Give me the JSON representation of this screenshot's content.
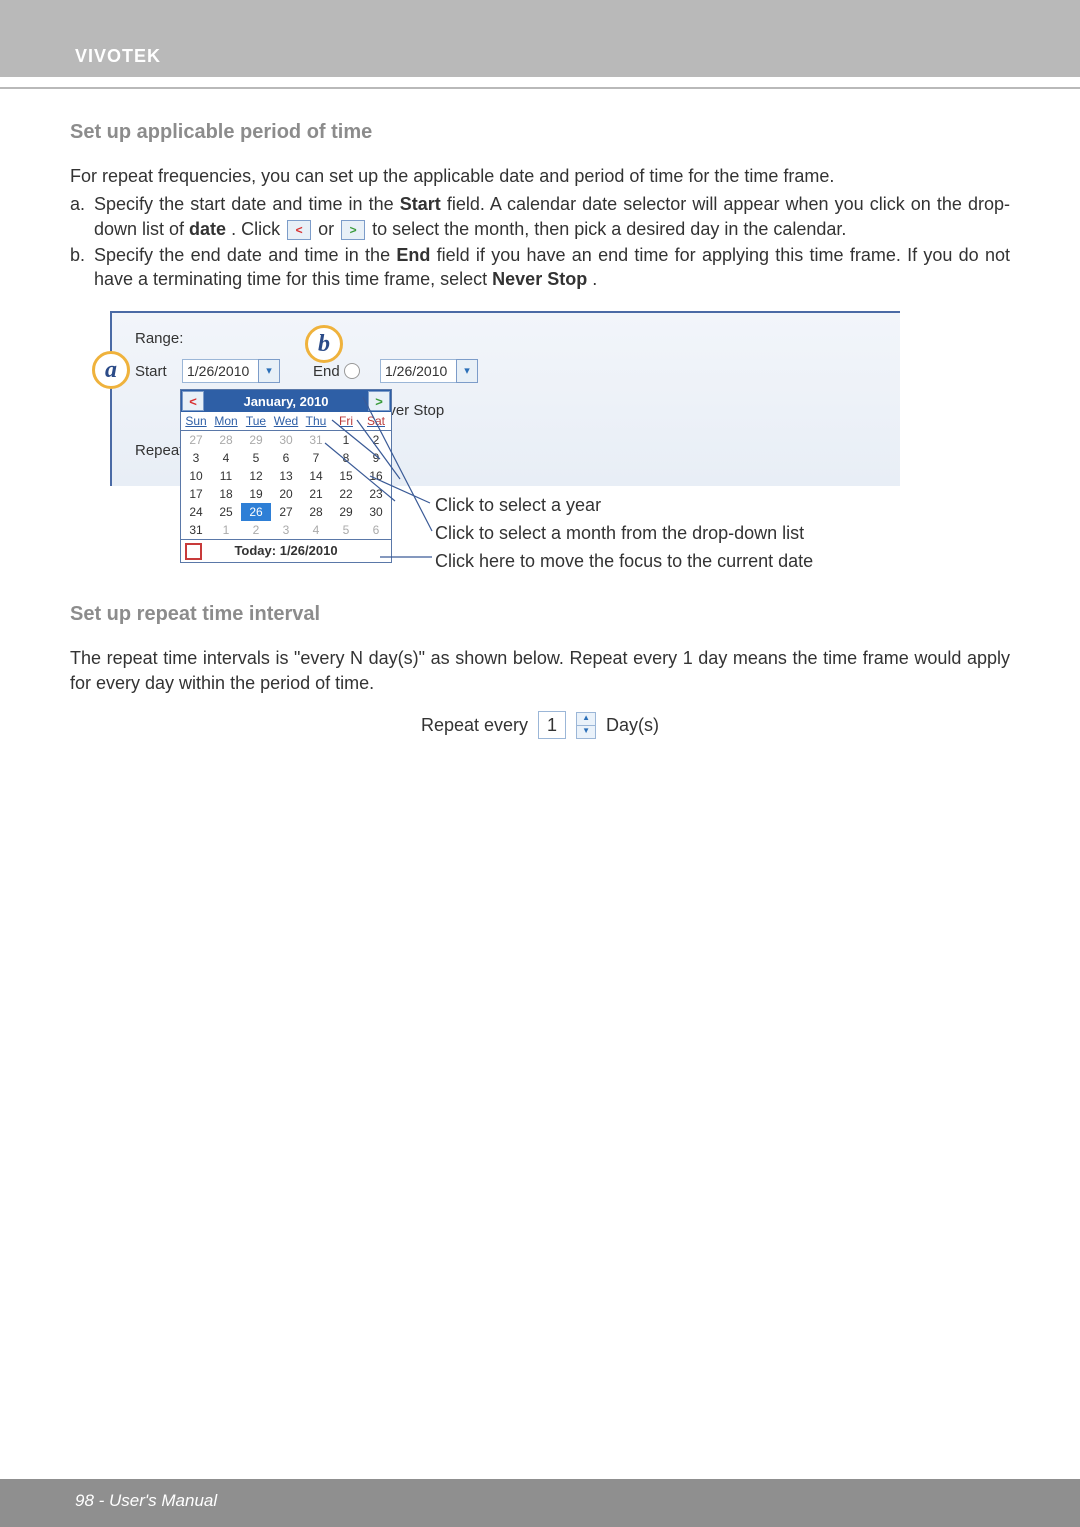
{
  "brand": "VIVOTEK",
  "h1": "Set up applicable period of time",
  "intro": "For repeat frequencies, you can set up the applicable date and period of time for the time frame.",
  "step_a": {
    "label": "a.",
    "text_pre": "Specify the start date and time in the ",
    "b1": "Start",
    "text_mid1": " field. A calendar date selector will appear when you click on the drop-down list of ",
    "b2": "date",
    "text_mid2": ". Click ",
    "text_mid3": " or ",
    "text_end": " to select the month, then pick a desired day in the calendar."
  },
  "step_b": {
    "label": "b.",
    "text_pre": "Specify the end date and time in the ",
    "b1": "End",
    "text_mid1": " field if you have an end time for applying this time frame. If you do not have a terminating time for this time frame, select ",
    "b2": "Never Stop",
    "text_end": "."
  },
  "figure1": {
    "range": "Range:",
    "start": "Start",
    "start_date": "1/26/2010",
    "end": "End",
    "end_date": "1/26/2010",
    "never_stop": "ever Stop",
    "repeat": "Repeat",
    "month_title": "January, 2010",
    "dow": [
      "Sun",
      "Mon",
      "Tue",
      "Wed",
      "Thu",
      "Fri",
      "Sat"
    ],
    "weeks": [
      [
        {
          "d": "27",
          "o": true
        },
        {
          "d": "28",
          "o": true
        },
        {
          "d": "29",
          "o": true
        },
        {
          "d": "30",
          "o": true
        },
        {
          "d": "31",
          "o": true
        },
        {
          "d": "1"
        },
        {
          "d": "2"
        }
      ],
      [
        {
          "d": "3"
        },
        {
          "d": "4"
        },
        {
          "d": "5"
        },
        {
          "d": "6"
        },
        {
          "d": "7"
        },
        {
          "d": "8"
        },
        {
          "d": "9"
        }
      ],
      [
        {
          "d": "10"
        },
        {
          "d": "11"
        },
        {
          "d": "12"
        },
        {
          "d": "13"
        },
        {
          "d": "14"
        },
        {
          "d": "15"
        },
        {
          "d": "16"
        }
      ],
      [
        {
          "d": "17"
        },
        {
          "d": "18"
        },
        {
          "d": "19"
        },
        {
          "d": "20"
        },
        {
          "d": "21"
        },
        {
          "d": "22"
        },
        {
          "d": "23"
        }
      ],
      [
        {
          "d": "24"
        },
        {
          "d": "25"
        },
        {
          "d": "26",
          "sel": true
        },
        {
          "d": "27"
        },
        {
          "d": "28"
        },
        {
          "d": "29"
        },
        {
          "d": "30"
        }
      ],
      [
        {
          "d": "31"
        },
        {
          "d": "1",
          "o": true
        },
        {
          "d": "2",
          "o": true
        },
        {
          "d": "3",
          "o": true
        },
        {
          "d": "4",
          "o": true
        },
        {
          "d": "5",
          "o": true
        },
        {
          "d": "6",
          "o": true
        }
      ]
    ],
    "today": "Today: 1/26/2010",
    "badge_a": "a",
    "badge_b": "b",
    "callout1": "Click to select a year",
    "callout2": "Click to select a month from the drop-down list",
    "callout3": "Click here to move the focus to the current date"
  },
  "h2": "Set up repeat time interval",
  "para2": "The repeat time intervals is \"every N day(s)\" as shown below. Repeat every 1 day means the time frame would apply for every day within the period of time.",
  "figure2": {
    "label": "Repeat every",
    "value": "1",
    "unit": "Day(s)"
  },
  "footer": "98 - User's Manual"
}
